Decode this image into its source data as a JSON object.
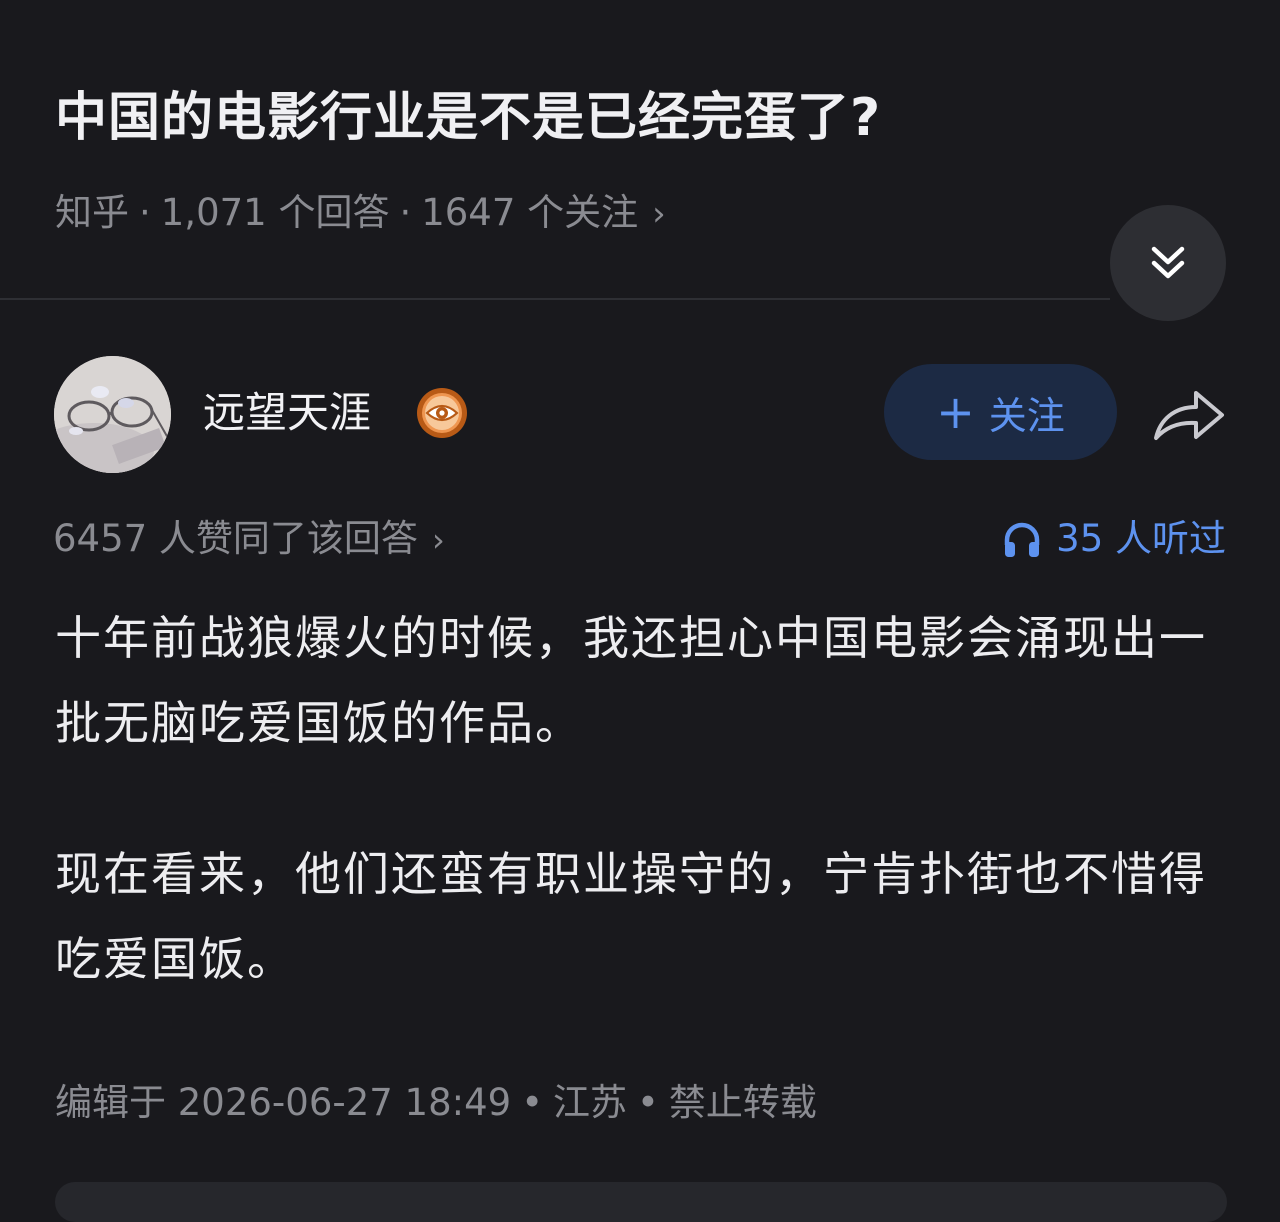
{
  "question": {
    "title": "中国的电影行业是不是已经完蛋了?",
    "source": "知乎",
    "separator": "·",
    "answers": "1,071 个回答",
    "followers": "1647 个关注",
    "chevron": "›"
  },
  "author": {
    "name": "远望天涯",
    "badge_icon": "eye-badge-icon",
    "follow_plus": "+",
    "follow_label": "关注",
    "share_icon": "share-arrow-icon"
  },
  "stats": {
    "votes": "6457 人赞同了该回答",
    "chevron": "›",
    "listen_icon": "headphones-icon",
    "listens": "35 人听过"
  },
  "answer": {
    "paragraphs": [
      "十年前战狼爆火的时候，我还担心中国电影会涌现出一批无脑吃爱国饭的作品。",
      "现在看来，他们还蛮有职业操守的，宁肯扑街也不惜得吃爱国饭。"
    ]
  },
  "footer": {
    "edited": "编辑于 2026-06-27 18:49",
    "separator": "•",
    "location": "江苏",
    "copyright": "禁止转载"
  },
  "colors": {
    "background": "#19191d",
    "accent": "#5d92ef",
    "muted_text": "#8a8b91",
    "badge": "#e8843a"
  }
}
